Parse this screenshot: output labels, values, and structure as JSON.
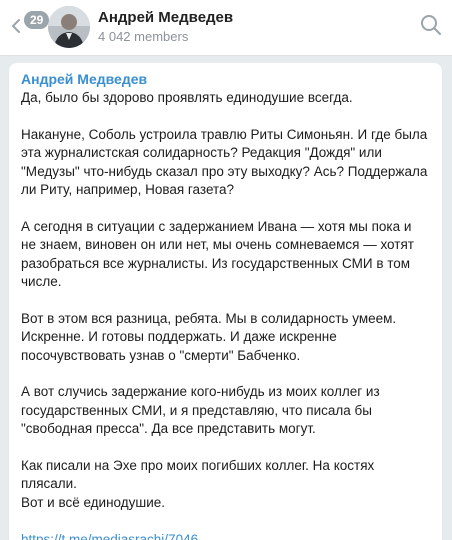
{
  "header": {
    "unread_count": "29",
    "title": "Андрей Медведев",
    "subtitle": "4 042 members"
  },
  "message": {
    "author": "Андрей Медведев",
    "paragraphs": [
      "Да, было бы здорово проявлять единодушие всегда.",
      "Накануне, Соболь устроила травлю Риты Симоньян. И где была эта журналистская солидарность? Редакция \"Дождя\" или \"Медузы\" что-нибудь сказал про эту выходку? Ась? Поддержала ли Риту, например, Новая газета?",
      "А сегодня в ситуации с задержанием Ивана — хотя мы пока и не знаем, виновен он или нет, мы очень сомневаемся —  хотят разобраться все журналисты. Из государственных СМИ в том числе.",
      "Вот в этом вся разница, ребята. Мы в солидарность умеем. Искренне. И готовы поддержать. И даже искренне посочувствовать узнав о \"смерти\" Бабченко.",
      "А вот случись задержание кого-нибудь из моих коллег из государственных СМИ, и я представляю, что писала бы \"свободная пресса\". Да все представить могут.",
      "Как писали на Эхе про моих погибших коллег. На костях плясали.\nВот и всё единодушие."
    ],
    "link": "https://t.me/mediasrachi/7046"
  },
  "icons": {
    "back": "arrow-left-icon",
    "search": "search-icon"
  },
  "colors": {
    "accent": "#3a8fd0",
    "background": "#e6ebee",
    "badge": "#9aa4ab"
  }
}
